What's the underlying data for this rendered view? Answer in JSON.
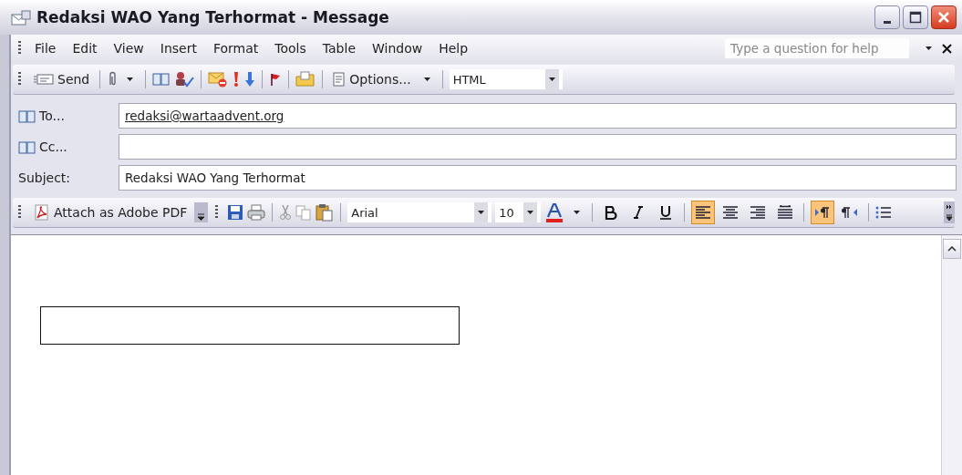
{
  "window": {
    "title": "Redaksi WAO Yang Terhormat - Message"
  },
  "menu": [
    {
      "label": "File"
    },
    {
      "label": "Edit"
    },
    {
      "label": "View"
    },
    {
      "label": "Insert"
    },
    {
      "label": "Format"
    },
    {
      "label": "Tools"
    },
    {
      "label": "Table"
    },
    {
      "label": "Window"
    },
    {
      "label": "Help"
    }
  ],
  "help_box": {
    "placeholder": "Type a question for help"
  },
  "standard_toolbar": {
    "send": "Send",
    "options": "Options...",
    "format": "HTML"
  },
  "fields": [
    {
      "kind": "address",
      "label": "To...",
      "value": "redaksi@wartaadvent.org"
    },
    {
      "kind": "address",
      "label": "Cc..."
    },
    {
      "kind": "plain",
      "label": "Subject:",
      "value": "Redaksi WAO Yang Terhormat"
    }
  ],
  "format_toolbar": {
    "attach": "Attach as Adobe PDF",
    "font": "Arial",
    "size": "10",
    "align_buttons": [
      {
        "selected": true
      },
      {
        "selected": false
      },
      {
        "selected": false
      },
      {
        "selected": false
      }
    ],
    "direction_buttons": [
      {
        "selected": true
      },
      {
        "selected": false
      }
    ]
  }
}
